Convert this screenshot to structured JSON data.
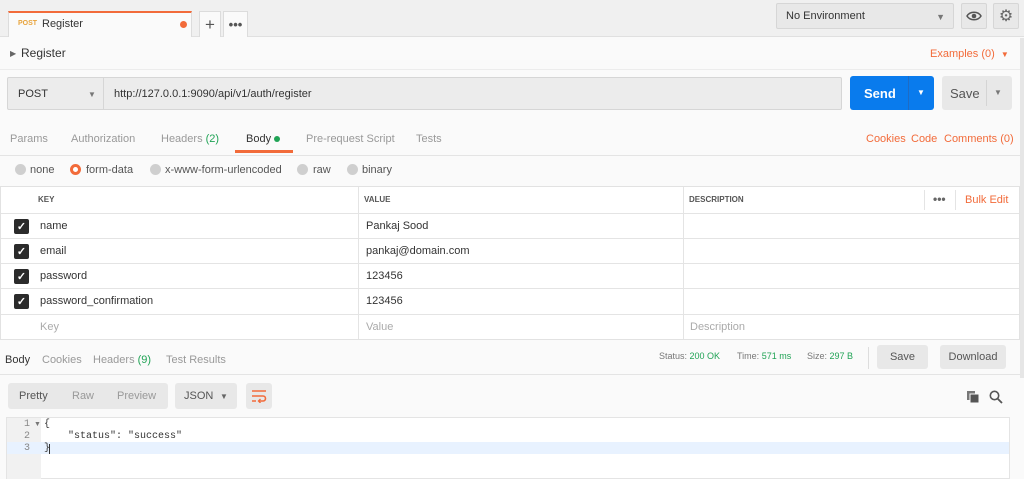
{
  "tabbar": {
    "tab": {
      "method": "POST",
      "name": "Register"
    },
    "add_label": "+",
    "more_label": "•••",
    "environment": "No Environment"
  },
  "request": {
    "title": "Register",
    "examples_link": "Examples (0)",
    "method": "POST",
    "url": "http://127.0.0.1:9090/api/v1/auth/register",
    "send_label": "Send",
    "save_label": "Save"
  },
  "request_tabs": {
    "params": "Params",
    "authorization": "Authorization",
    "headers": "Headers",
    "headers_count": "(2)",
    "body": "Body",
    "pre_request": "Pre-request Script",
    "tests": "Tests",
    "cookies": "Cookies",
    "code": "Code",
    "comments": "Comments (0)"
  },
  "body_types": {
    "none": "none",
    "form_data": "form-data",
    "urlencoded": "x-www-form-urlencoded",
    "raw": "raw",
    "binary": "binary",
    "selected": "form-data"
  },
  "params_table": {
    "headers": {
      "key": "KEY",
      "value": "VALUE",
      "description": "DESCRIPTION"
    },
    "more_label": "•••",
    "bulk_edit": "Bulk Edit",
    "rows": [
      {
        "key": "name",
        "value": "Pankaj Sood",
        "checked": true
      },
      {
        "key": "email",
        "value": "pankaj@domain.com",
        "checked": true
      },
      {
        "key": "password",
        "value": "123456",
        "checked": true
      },
      {
        "key": "password_confirmation",
        "value": "123456",
        "checked": true
      }
    ],
    "placeholders": {
      "key": "Key",
      "value": "Value",
      "description": "Description"
    }
  },
  "response": {
    "tabs": {
      "body": "Body",
      "cookies": "Cookies",
      "headers": "Headers",
      "headers_count": "(9)",
      "test_results": "Test Results"
    },
    "status_label": "Status:",
    "status_value": "200 OK",
    "time_label": "Time:",
    "time_value": "571 ms",
    "size_label": "Size:",
    "size_value": "297 B",
    "save_label": "Save",
    "download_label": "Download",
    "formats": {
      "pretty": "Pretty",
      "raw": "Raw",
      "preview": "Preview"
    },
    "language": "JSON",
    "code_lines": [
      {
        "num": "1",
        "text": "{"
      },
      {
        "num": "2",
        "text": "    \"status\": \"success\""
      },
      {
        "num": "3",
        "text": "}"
      }
    ]
  },
  "colors": {
    "accent": "#f26b3a",
    "send_blue": "#097bed",
    "success_green": "#20a355",
    "method_post": "#e8a33b"
  }
}
